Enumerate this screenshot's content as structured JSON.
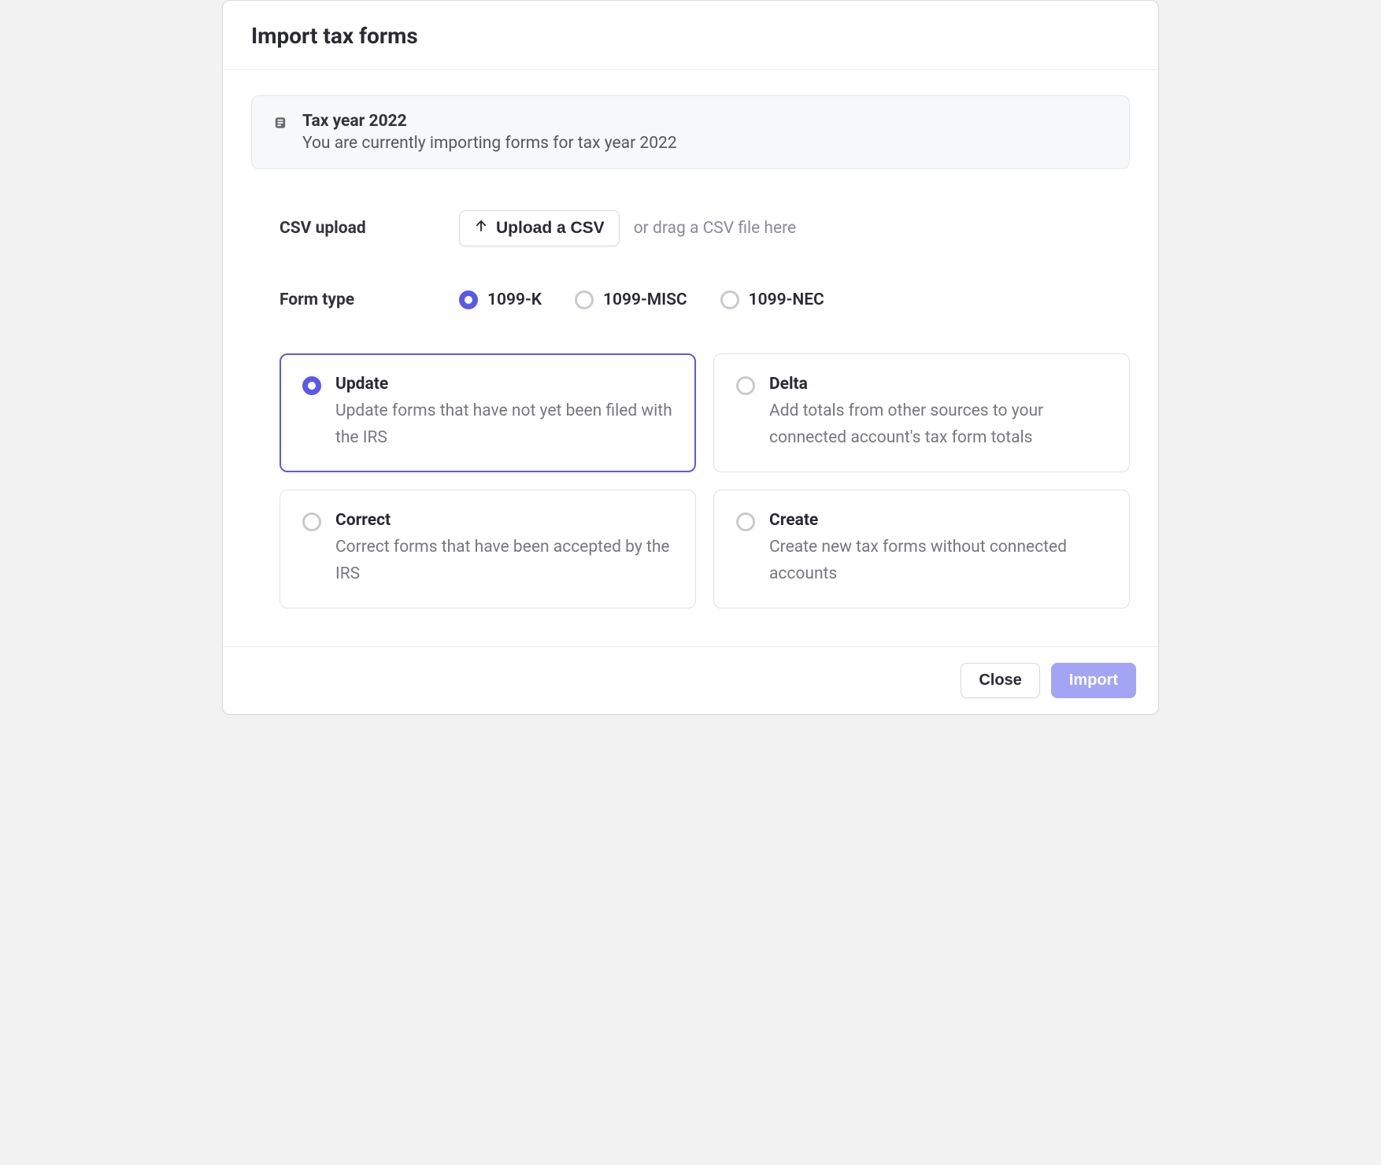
{
  "header": {
    "title": "Import tax forms"
  },
  "notice": {
    "title": "Tax year 2022",
    "subtitle": "You are currently importing forms for tax year 2022"
  },
  "csv": {
    "label": "CSV upload",
    "button_label": "Upload a CSV",
    "hint": "or drag a CSV file here"
  },
  "form_type": {
    "label": "Form type",
    "options": [
      {
        "label": "1099-K",
        "selected": true
      },
      {
        "label": "1099-MISC",
        "selected": false
      },
      {
        "label": "1099-NEC",
        "selected": false
      }
    ]
  },
  "action_cards": [
    {
      "title": "Update",
      "desc": "Update forms that have not yet been filed with the IRS",
      "selected": true
    },
    {
      "title": "Delta",
      "desc": "Add totals from other sources to your connected account's tax form totals",
      "selected": false
    },
    {
      "title": "Correct",
      "desc": "Correct forms that have been accepted by the IRS",
      "selected": false
    },
    {
      "title": "Create",
      "desc": "Create new tax forms without connected accounts",
      "selected": false
    }
  ],
  "footer": {
    "close_label": "Close",
    "import_label": "Import"
  }
}
